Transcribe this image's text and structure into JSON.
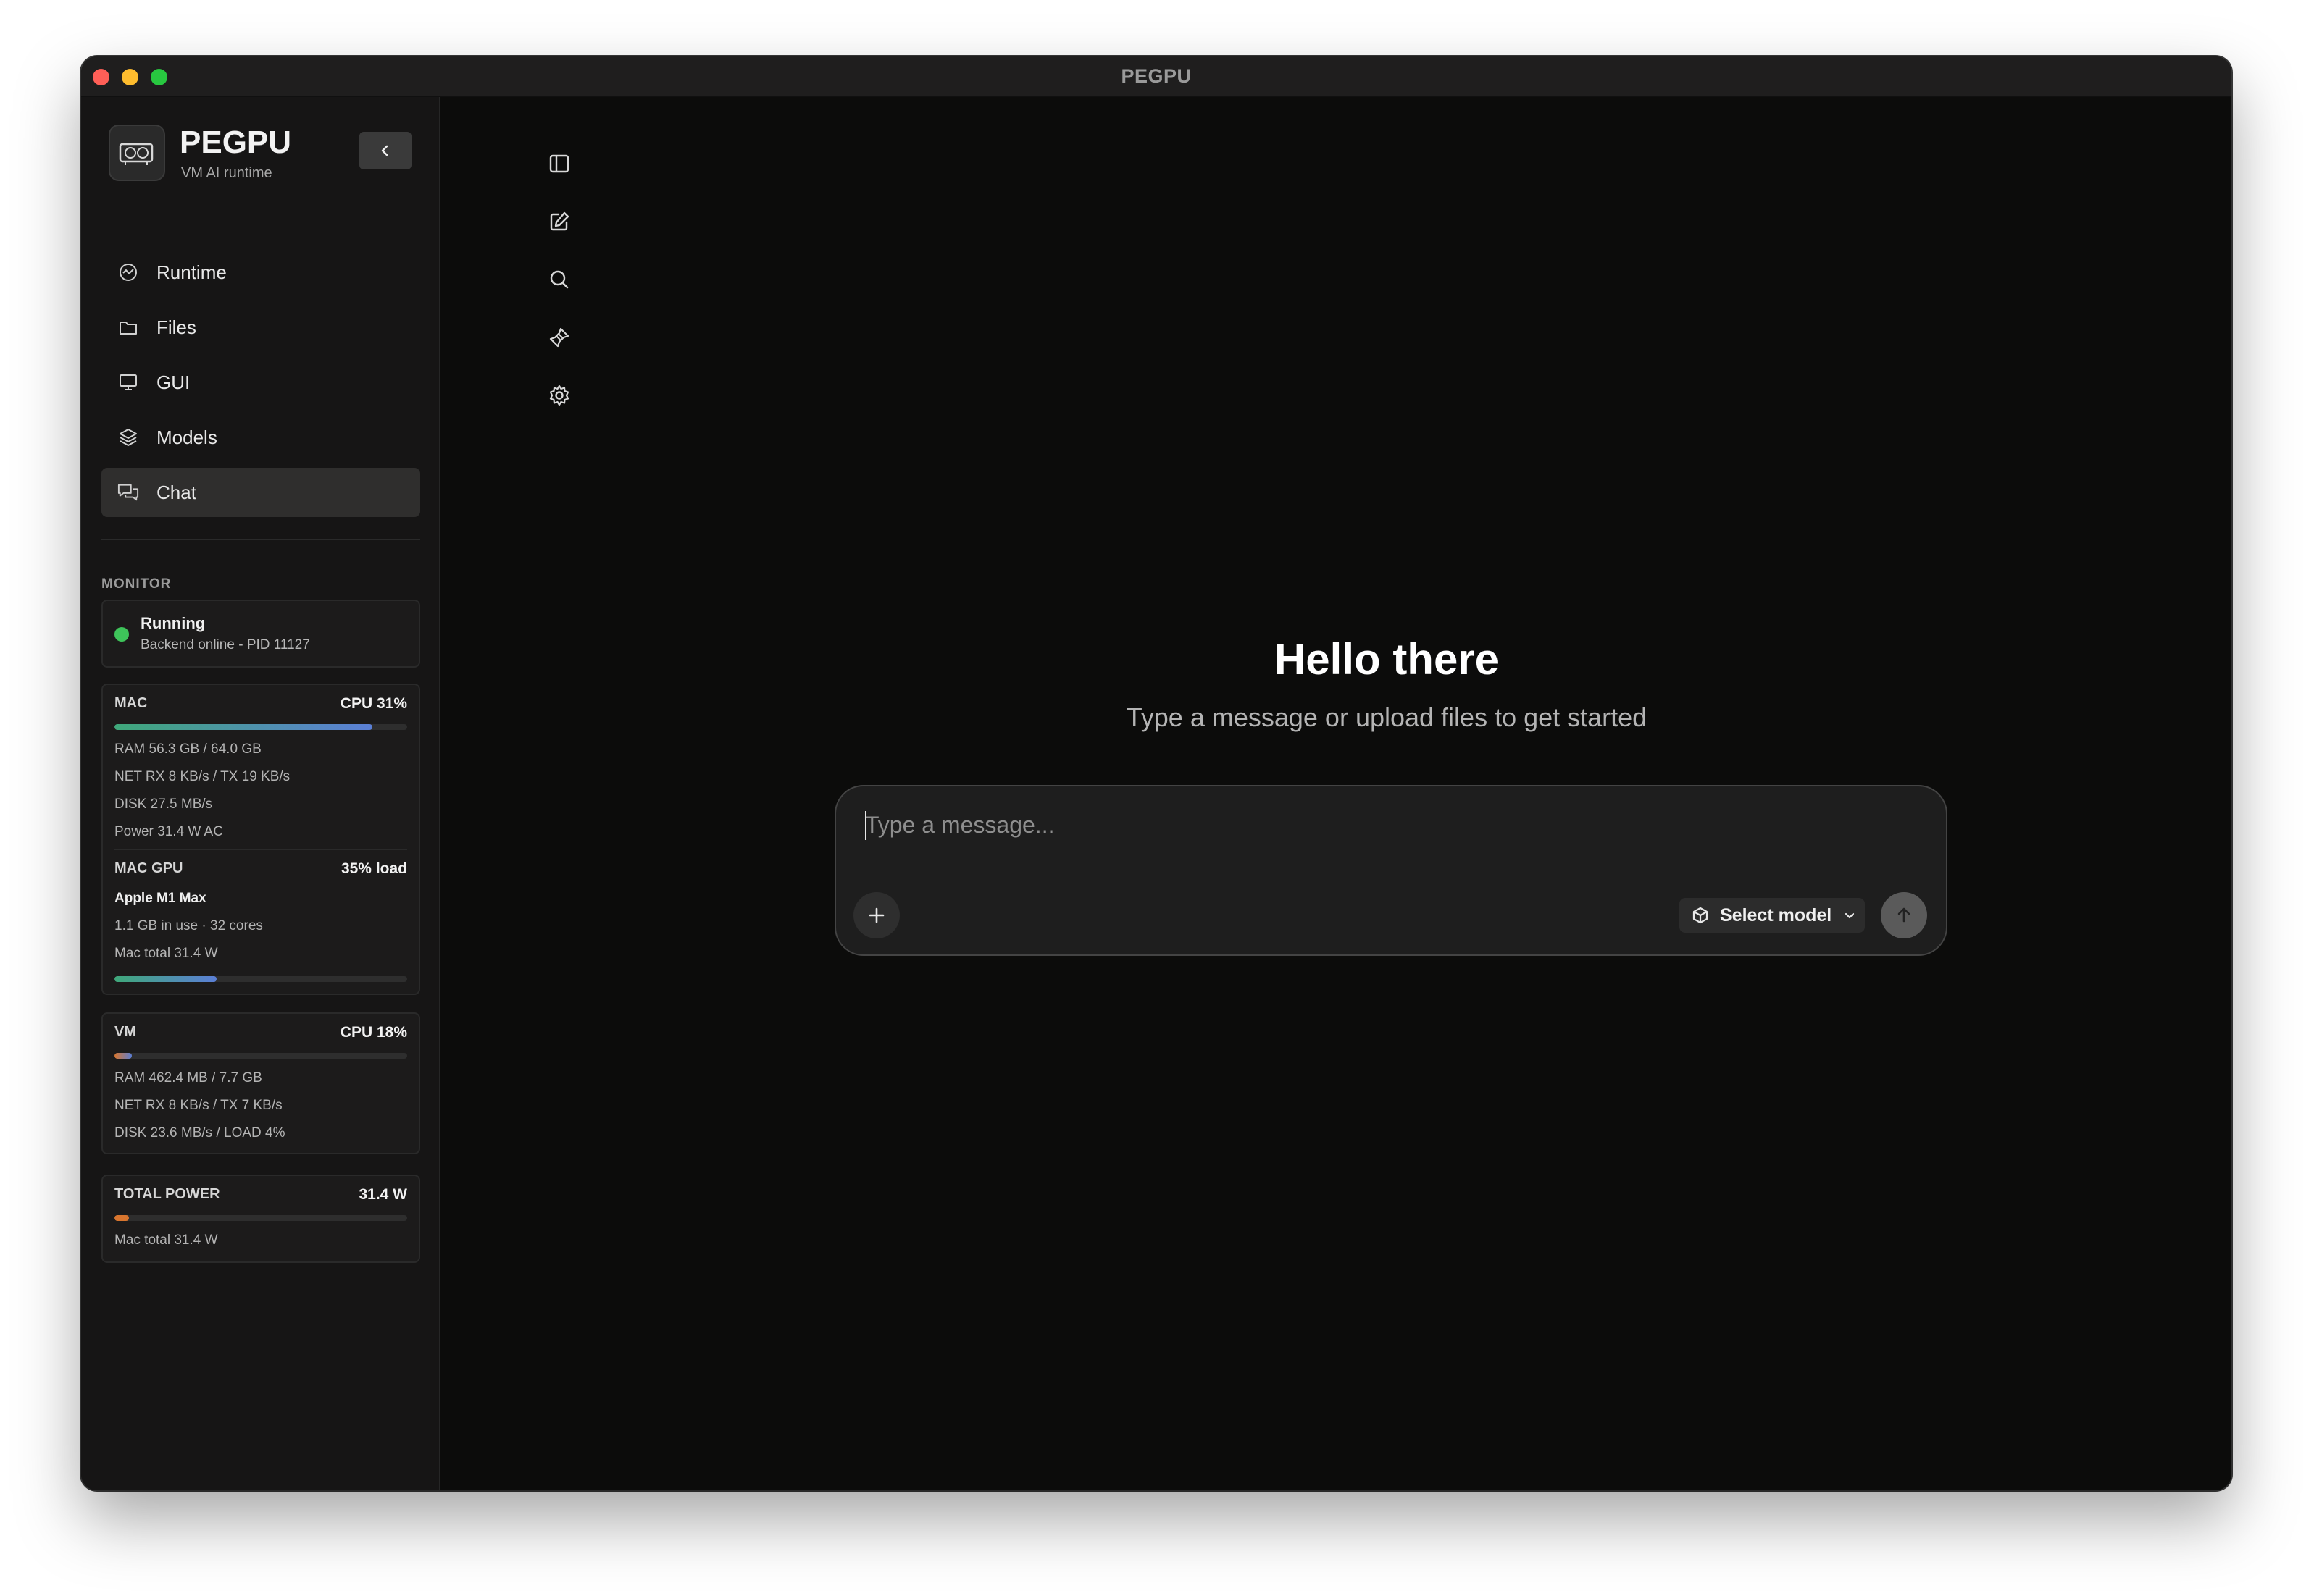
{
  "window": {
    "title": "PEGPU"
  },
  "brand": {
    "name": "PEGPU",
    "subtitle": "VM AI runtime"
  },
  "nav": {
    "items": [
      {
        "label": "Runtime",
        "icon": "runtime-icon",
        "active": false
      },
      {
        "label": "Files",
        "icon": "folder-icon",
        "active": false
      },
      {
        "label": "GUI",
        "icon": "monitor-icon",
        "active": false
      },
      {
        "label": "Models",
        "icon": "layers-icon",
        "active": false
      },
      {
        "label": "Chat",
        "icon": "chat-icon",
        "active": true
      }
    ]
  },
  "monitor": {
    "label": "MONITOR",
    "status": {
      "title": "Running",
      "subtitle": "Backend online - PID 11127",
      "color": "#3ec45a"
    },
    "mac": {
      "label": "MAC",
      "cpu": "CPU 31%",
      "bar_fraction": 0.88,
      "ram": "RAM 56.3 GB / 64.0 GB",
      "net": "NET RX 8 KB/s / TX 19 KB/s",
      "disk": "DISK 27.5 MB/s",
      "power": "Power 31.4 W AC"
    },
    "gpu": {
      "label": "MAC GPU",
      "load": "35% load",
      "name": "Apple M1 Max",
      "usage": "1.1 GB in use · 32 cores",
      "power": "Mac total 31.4 W",
      "bar_fraction": 0.35
    },
    "vm": {
      "label": "VM",
      "cpu": "CPU 18%",
      "bar_fraction": 0.06,
      "ram": "RAM 462.4 MB / 7.7 GB",
      "net": "NET RX 8 KB/s / TX 7 KB/s",
      "disk": "DISK 23.6 MB/s / LOAD 4%"
    },
    "total_power": {
      "label": "TOTAL POWER",
      "value": "31.4 W",
      "sub": "Mac total 31.4 W",
      "bar_fraction": 0.05
    }
  },
  "rail": {
    "icons": [
      "sidebar-toggle-icon",
      "new-chat-icon",
      "search-icon",
      "pin-icon",
      "settings-gear-icon"
    ]
  },
  "main": {
    "greeting": "Hello there",
    "subtitle": "Type a message or upload files to get started",
    "composer": {
      "placeholder": "Type a message...",
      "model_label": "Select model"
    }
  },
  "colors": {
    "accent_green": "#3ec45a",
    "bar_blue": "#5b7fd6",
    "bar_orange": "#d8752e"
  }
}
